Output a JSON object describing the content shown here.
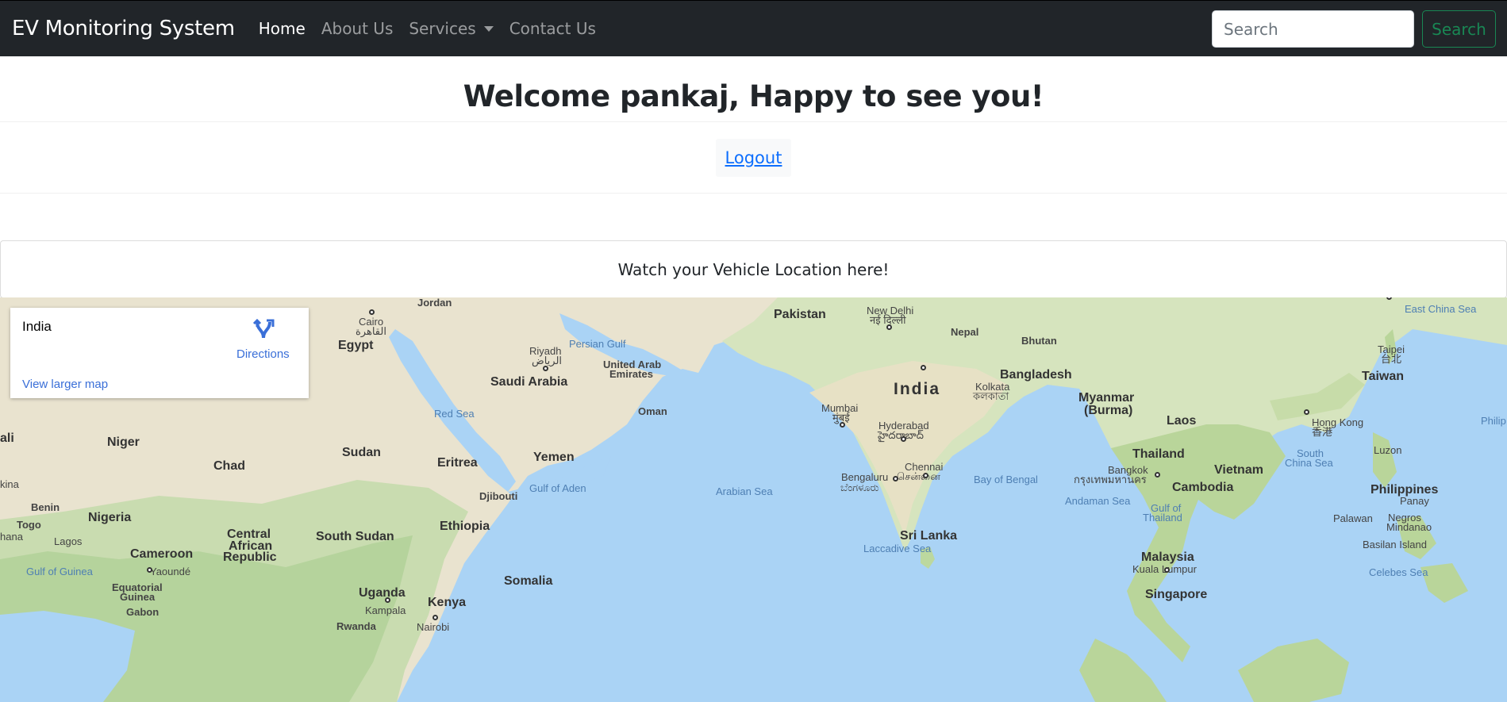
{
  "navbar": {
    "brand": "EV Monitoring System",
    "links": [
      {
        "label": "Home"
      },
      {
        "label": "About Us"
      },
      {
        "label": "Services"
      },
      {
        "label": "Contact Us"
      }
    ],
    "search_placeholder": "Search",
    "search_button": "Search"
  },
  "welcome": {
    "heading": "Welcome pankaj, Happy to see you!",
    "logout": "Logout"
  },
  "location": {
    "text": "Watch your Vehicle Location here!"
  },
  "map": {
    "info_card": {
      "title": "India",
      "directions": "Directions",
      "larger_map": "View larger map"
    },
    "labels": {
      "jordan": "Jordan",
      "cairo": "Cairo",
      "cairo_ar": "القاهرة",
      "egypt": "Egypt",
      "riyadh": "Riyadh",
      "riyadh_ar": "الرياض",
      "persian_gulf": "Persian Gulf",
      "uae_1": "United Arab",
      "uae_2": "Emirates",
      "saudi_arabia": "Saudi Arabia",
      "pakistan": "Pakistan",
      "new_delhi": "New Delhi",
      "new_delhi_hi": "नई दिल्ली",
      "nepal": "Nepal",
      "bhutan": "Bhutan",
      "east_china_sea": "East China Sea",
      "taipei": "Taipei",
      "taipei_zh": "台北",
      "taiwan": "Taiwan",
      "india": "India",
      "bangladesh": "Bangladesh",
      "kolkata": "Kolkata",
      "kolkata_bn": "কলকাতা",
      "myanmar_1": "Myanmar",
      "myanmar_2": "(Burma)",
      "hong_kong": "Hong Kong",
      "hong_kong_zh": "香港",
      "phili": "Philip",
      "oman": "Oman",
      "red_sea": "Red Sea",
      "mumbai": "Mumbai",
      "mumbai_mr": "मुंबई",
      "hyderabad": "Hyderabad",
      "hyderabad_te": "హైదరాబాద్",
      "laos": "Laos",
      "ali": "ali",
      "niger": "Niger",
      "chad": "Chad",
      "sudan": "Sudan",
      "eritrea": "Eritrea",
      "yemen": "Yemen",
      "thailand": "Thailand",
      "vietnam": "Vietnam",
      "luzon": "Luzon",
      "south_china_sea_1": "South",
      "south_china_sea_2": "China Sea",
      "chennai": "Chennai",
      "chennai_ta": "சென்னை",
      "bay_of_bengal": "Bay of Bengal",
      "bangkok": "Bangkok",
      "bangkok_th": "กรุงเทพมหานคร",
      "kina": "kina",
      "gulf_of_aden": "Gulf of Aden",
      "djibouti": "Djibouti",
      "arabian_sea": "Arabian Sea",
      "bengaluru": "Bengaluru",
      "bengaluru_kn": "ಬೆಂಗಳೂರು",
      "cambodia": "Cambodia",
      "philippines": "Philippines",
      "andaman_sea": "Andaman Sea",
      "panay": "Panay",
      "benin": "Benin",
      "nigeria": "Nigeria",
      "gulf_of_thailand_1": "Gulf of",
      "gulf_of_thailand_2": "Thailand",
      "palawan": "Palawan",
      "negros": "Negros",
      "togo": "Togo",
      "ethiopia": "Ethiopia",
      "mindanao": "Mindanao",
      "central_african_1": "Central",
      "central_african_2": "African",
      "central_african_3": "Republic",
      "south_sudan": "South Sudan",
      "sri_lanka": "Sri Lanka",
      "hana": "hana",
      "lagos": "Lagos",
      "basilan": "Basilan Island",
      "cameroon": "Cameroon",
      "laccadive_sea": "Laccadive Sea",
      "malaysia": "Malaysia",
      "gulf_of_guinea": "Gulf of Guinea",
      "yaounde": "Yaoundé",
      "kuala_lumpur": "Kuala Lumpur",
      "celebes_sea": "Celebes Sea",
      "somalia": "Somalia",
      "equatorial_guinea_1": "Equatorial",
      "equatorial_guinea_2": "Guinea",
      "uganda": "Uganda",
      "singapore": "Singapore",
      "kenya": "Kenya",
      "kampala": "Kampala",
      "gabon": "Gabon",
      "rwanda": "Rwanda",
      "nairobi": "Nairobi"
    }
  }
}
